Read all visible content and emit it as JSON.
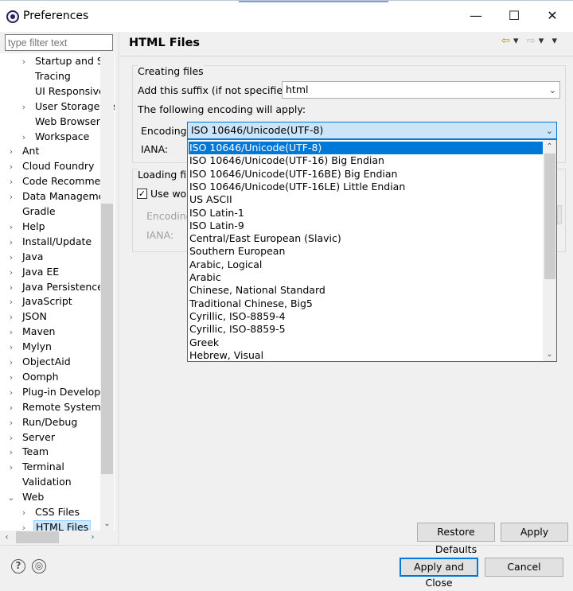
{
  "window": {
    "title": "Preferences",
    "minimize": "—",
    "maximize": "☐",
    "close": "✕"
  },
  "filter": {
    "placeholder": "type filter text"
  },
  "tree": {
    "items": [
      {
        "label": "Startup and Sh",
        "indent": 1,
        "chevron": "›"
      },
      {
        "label": "Tracing",
        "indent": 1,
        "chevron": ""
      },
      {
        "label": "UI Responsiven",
        "indent": 1,
        "chevron": ""
      },
      {
        "label": "User Storage Se",
        "indent": 1,
        "chevron": "›"
      },
      {
        "label": "Web Browser",
        "indent": 1,
        "chevron": ""
      },
      {
        "label": "Workspace",
        "indent": 1,
        "chevron": "›"
      },
      {
        "label": "Ant",
        "indent": 0,
        "chevron": "›"
      },
      {
        "label": "Cloud Foundry",
        "indent": 0,
        "chevron": "›"
      },
      {
        "label": "Code Recommen",
        "indent": 0,
        "chevron": "›"
      },
      {
        "label": "Data Managemen",
        "indent": 0,
        "chevron": "›"
      },
      {
        "label": "Gradle",
        "indent": 0,
        "chevron": ""
      },
      {
        "label": "Help",
        "indent": 0,
        "chevron": "›"
      },
      {
        "label": "Install/Update",
        "indent": 0,
        "chevron": "›"
      },
      {
        "label": "Java",
        "indent": 0,
        "chevron": "›"
      },
      {
        "label": "Java EE",
        "indent": 0,
        "chevron": "›"
      },
      {
        "label": "Java Persistence",
        "indent": 0,
        "chevron": "›"
      },
      {
        "label": "JavaScript",
        "indent": 0,
        "chevron": "›"
      },
      {
        "label": "JSON",
        "indent": 0,
        "chevron": "›"
      },
      {
        "label": "Maven",
        "indent": 0,
        "chevron": "›"
      },
      {
        "label": "Mylyn",
        "indent": 0,
        "chevron": "›"
      },
      {
        "label": "ObjectAid",
        "indent": 0,
        "chevron": "›"
      },
      {
        "label": "Oomph",
        "indent": 0,
        "chevron": "›"
      },
      {
        "label": "Plug-in Developm",
        "indent": 0,
        "chevron": "›"
      },
      {
        "label": "Remote Systems",
        "indent": 0,
        "chevron": "›"
      },
      {
        "label": "Run/Debug",
        "indent": 0,
        "chevron": "›"
      },
      {
        "label": "Server",
        "indent": 0,
        "chevron": "›"
      },
      {
        "label": "Team",
        "indent": 0,
        "chevron": "›"
      },
      {
        "label": "Terminal",
        "indent": 0,
        "chevron": "›"
      },
      {
        "label": "Validation",
        "indent": 0,
        "chevron": ""
      },
      {
        "label": "Web",
        "indent": 0,
        "chevron": "⌄"
      },
      {
        "label": "CSS Files",
        "indent": 1,
        "chevron": "›"
      },
      {
        "label": "HTML Files",
        "indent": 1,
        "chevron": "›",
        "selected": true
      }
    ]
  },
  "page": {
    "title": "HTML Files",
    "creating": {
      "group_label": "Creating files",
      "suffix_label": "Add this suffix (if not specified):",
      "suffix_value": "html",
      "encoding_note": "The following encoding will apply:",
      "encoding_label": "Encoding:",
      "encoding_value": "ISO 10646/Unicode(UTF-8)",
      "iana_label": "IANA:"
    },
    "loading": {
      "group_label": "Loading file",
      "use_checkbox_label": "Use wor",
      "encoding_label": "Encoding",
      "iana_label": "IANA:"
    }
  },
  "encoding_options": [
    "ISO 10646/Unicode(UTF-8)",
    "ISO 10646/Unicode(UTF-16) Big Endian",
    "ISO 10646/Unicode(UTF-16BE) Big Endian",
    "ISO 10646/Unicode(UTF-16LE) Little Endian",
    "US ASCII",
    "ISO Latin-1",
    "ISO Latin-9",
    "Central/East European (Slavic)",
    "Southern European",
    "Arabic, Logical",
    "Arabic",
    "Chinese, National Standard",
    "Traditional Chinese, Big5",
    "Cyrillic, ISO-8859-4",
    "Cyrillic, ISO-8859-5",
    "Greek",
    "Hebrew, Visual"
  ],
  "buttons": {
    "restore_defaults": "Restore Defaults",
    "apply": "Apply",
    "apply_and_close": "Apply and Close",
    "cancel": "Cancel"
  },
  "icons": {
    "help": "?",
    "import_export": "◎",
    "back": "⇦",
    "forward": "⇨",
    "menu": "▾"
  },
  "colors": {
    "selection": "#0078d7",
    "combo_focus": "#cce4f7"
  }
}
